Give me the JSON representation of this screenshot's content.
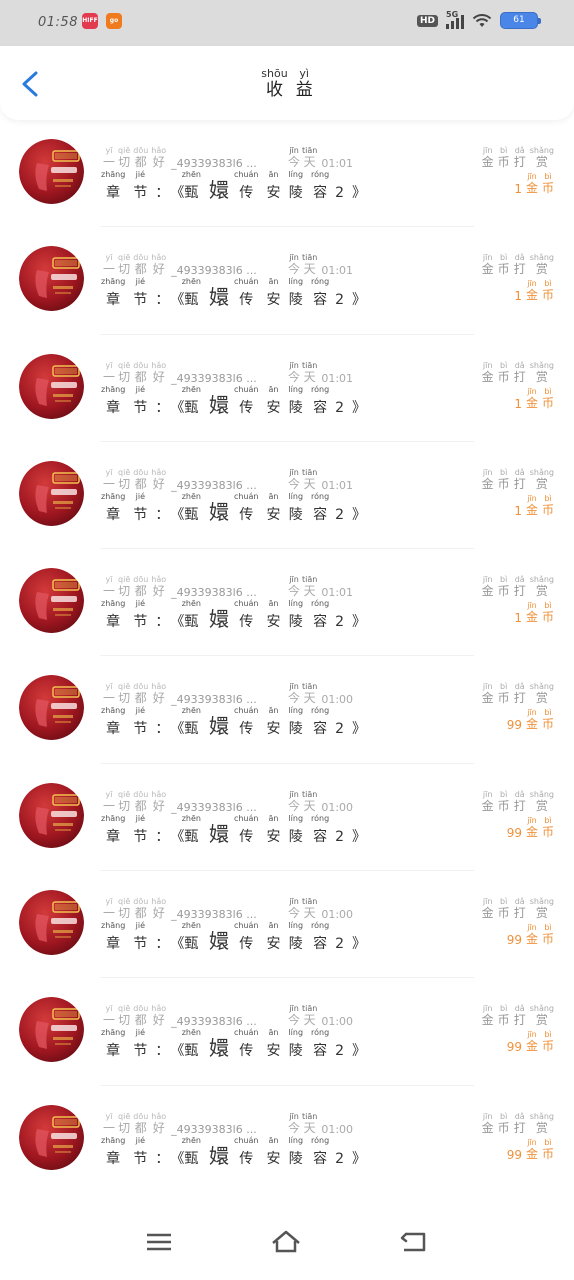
{
  "status_bar": {
    "time": "01:58",
    "app_icons": [
      {
        "name": "red-app-icon",
        "color": "#e23a4f",
        "label": "HIFF"
      },
      {
        "name": "orange-app-icon",
        "color": "#f07a1e",
        "label": "go"
      }
    ],
    "hd": "HD",
    "network": "5G",
    "battery": "61",
    "bg": "#dcdcdc"
  },
  "header": {
    "back_icon": "chevron-left-icon",
    "title": [
      {
        "char": "收",
        "pinyin": "shōu"
      },
      {
        "char": "益",
        "pinyin": "yì"
      }
    ],
    "accent": "#2a7bde"
  },
  "labels": {
    "user": [
      {
        "char": "一",
        "pinyin": "yī"
      },
      {
        "char": "切",
        "pinyin": "qiē"
      },
      {
        "char": "都",
        "pinyin": "dōu"
      },
      {
        "char": "好",
        "pinyin": "hǎo"
      }
    ],
    "today": [
      {
        "char": "今",
        "pinyin": "jīn"
      },
      {
        "char": "天",
        "pinyin": "tiān"
      }
    ],
    "chapter_label": [
      {
        "char": "章",
        "pinyin": "zhāng"
      },
      {
        "char": "节",
        "pinyin": "jié"
      }
    ],
    "colon": "：",
    "open_quote": "《",
    "close_quote": "》",
    "book_title": [
      {
        "char": "甄",
        "pinyin": "zhēn"
      },
      {
        "char": "嬛",
        "pinyin": ""
      },
      {
        "char": "传",
        "pinyin": "chuán"
      },
      {
        "char": "安",
        "pinyin": "ān"
      },
      {
        "char": "陵",
        "pinyin": "líng"
      },
      {
        "char": "容",
        "pinyin": "róng"
      }
    ],
    "book_suffix": "2",
    "tip": [
      {
        "char": "金",
        "pinyin": "jīn"
      },
      {
        "char": "币",
        "pinyin": "bì"
      },
      {
        "char": "打",
        "pinyin": "dǎ"
      },
      {
        "char": "赏",
        "pinyin": "shǎng"
      }
    ],
    "coin": [
      {
        "char": "金",
        "pinyin": "jīn"
      },
      {
        "char": "币",
        "pinyin": "bì"
      }
    ],
    "amount_color": "#f0913a"
  },
  "rows": [
    {
      "user_id": "_49339383l6 ...",
      "time": "01:01",
      "amount": "1"
    },
    {
      "user_id": "_49339383l6 ...",
      "time": "01:01",
      "amount": "1"
    },
    {
      "user_id": "_49339383l6 ...",
      "time": "01:01",
      "amount": "1"
    },
    {
      "user_id": "_49339383l6 ...",
      "time": "01:01",
      "amount": "1"
    },
    {
      "user_id": "_49339383l6 ...",
      "time": "01:01",
      "amount": "1"
    },
    {
      "user_id": "_49339383l6 ...",
      "time": "01:00",
      "amount": "99"
    },
    {
      "user_id": "_49339383l6 ...",
      "time": "01:00",
      "amount": "99"
    },
    {
      "user_id": "_49339383l6 ...",
      "time": "01:00",
      "amount": "99"
    },
    {
      "user_id": "_49339383l6 ...",
      "time": "01:00",
      "amount": "99"
    },
    {
      "user_id": "_49339383l6 ...",
      "time": "01:00",
      "amount": "99"
    }
  ],
  "nav": {
    "menu_icon": "menu-icon",
    "home_icon": "home-icon",
    "back_icon": "back-icon"
  }
}
